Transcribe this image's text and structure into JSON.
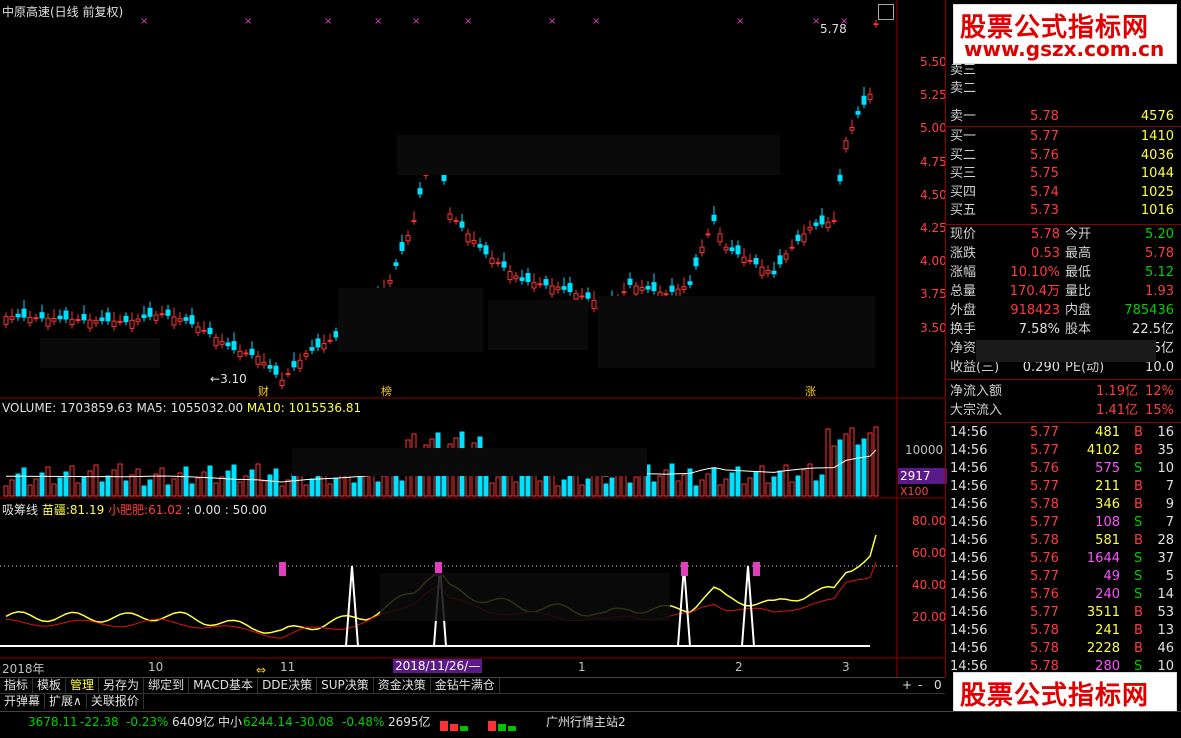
{
  "title": "中原高速(日线 前复权)",
  "colors": {
    "up": "#ff3232",
    "down": "#00e0ff",
    "bg": "#000000",
    "grid": "#8b0000",
    "ma5": "#ffffff",
    "ma10": "#ffff00"
  },
  "price_axis": [
    "5.50",
    "5.25",
    "5.00",
    "4.75",
    "4.50",
    "4.25",
    "4.00",
    "3.75",
    "3.50"
  ],
  "price_high_label": "5.78",
  "price_low_label": "3.10",
  "event_markers": [
    "财",
    "榜",
    "涨"
  ],
  "volume_header": {
    "prefix": "VOLUME:",
    "value": "1703859.63",
    "ma5_label": "MA5:",
    "ma5": "1055032.00",
    "ma10_label": "MA10:",
    "ma10": "1015536.81"
  },
  "volume_axis": [
    "10000"
  ],
  "volume_tag": "2917",
  "volume_unit": "X100",
  "indicator_header": {
    "name": "吸筹线",
    "a_label": "苗疆:",
    "a": "81.19",
    "b_label": "小肥肥:",
    "b": "61.02",
    "c": ": 0.00",
    "d": ": 50.00"
  },
  "indicator_axis": [
    "80.00",
    "60.00",
    "40.00",
    "20.00"
  ],
  "time_axis": [
    "2018年",
    "10",
    "11",
    "1",
    "2",
    "3"
  ],
  "time_cursor": "2018/11/26/—",
  "quote": {
    "asks": [
      {
        "label": "卖三",
        "price": "",
        "vol": ""
      },
      {
        "label": "卖二",
        "price": "",
        "vol": ""
      },
      {
        "label": "卖一",
        "price": "5.78",
        "vol": "4576"
      }
    ],
    "bids": [
      {
        "label": "买一",
        "price": "5.77",
        "vol": "1410"
      },
      {
        "label": "买二",
        "price": "5.76",
        "vol": "4036"
      },
      {
        "label": "买三",
        "price": "5.75",
        "vol": "1044"
      },
      {
        "label": "买四",
        "price": "5.74",
        "vol": "1025"
      },
      {
        "label": "买五",
        "price": "5.73",
        "vol": "1016"
      }
    ],
    "stats": [
      {
        "l1": "现价",
        "v1": "5.78",
        "l2": "今开",
        "v2": "5.20"
      },
      {
        "l1": "涨跌",
        "v1": "0.53",
        "l2": "最高",
        "v2": "5.78"
      },
      {
        "l1": "涨幅",
        "v1": "10.10%",
        "l2": "最低",
        "v2": "5.12"
      },
      {
        "l1": "总量",
        "v1": "170.4万",
        "l2": "量比",
        "v2": "1.93"
      },
      {
        "l1": "外盘",
        "v1": "918423",
        "l2": "内盘",
        "v2": "785436"
      },
      {
        "l1": "换手",
        "v1": "7.58%",
        "l2": "股本",
        "v2": "22.5亿"
      },
      {
        "l1": "净资",
        "v1": "",
        "l2": "",
        "v2": "22.5亿"
      },
      {
        "l1": "收益(三)",
        "v1": "0.290",
        "l2": "PE(动)",
        "v2": "10.0"
      }
    ],
    "flows": [
      {
        "label": "净流入额",
        "value": "1.19亿",
        "pct": "12%"
      },
      {
        "label": "大宗流入",
        "value": "1.41亿",
        "pct": "15%"
      }
    ]
  },
  "ticks": [
    {
      "time": "14:56",
      "price": "5.77",
      "vol": "481",
      "side": "B",
      "n": "16"
    },
    {
      "time": "14:56",
      "price": "5.77",
      "vol": "4102",
      "side": "B",
      "n": "35"
    },
    {
      "time": "14:56",
      "price": "5.76",
      "vol": "575",
      "side": "S",
      "n": "10"
    },
    {
      "time": "14:56",
      "price": "5.77",
      "vol": "211",
      "side": "B",
      "n": "7"
    },
    {
      "time": "14:56",
      "price": "5.78",
      "vol": "346",
      "side": "B",
      "n": "9"
    },
    {
      "time": "14:56",
      "price": "5.77",
      "vol": "108",
      "side": "S",
      "n": "7"
    },
    {
      "time": "14:56",
      "price": "5.78",
      "vol": "581",
      "side": "B",
      "n": "28"
    },
    {
      "time": "14:56",
      "price": "5.76",
      "vol": "1644",
      "side": "S",
      "n": "37"
    },
    {
      "time": "14:56",
      "price": "5.77",
      "vol": "49",
      "side": "S",
      "n": "5"
    },
    {
      "time": "14:56",
      "price": "5.76",
      "vol": "240",
      "side": "S",
      "n": "14"
    },
    {
      "time": "14:56",
      "price": "5.77",
      "vol": "3511",
      "side": "B",
      "n": "53"
    },
    {
      "time": "14:56",
      "price": "5.78",
      "vol": "241",
      "side": "B",
      "n": "13"
    },
    {
      "time": "14:56",
      "price": "5.78",
      "vol": "2228",
      "side": "B",
      "n": "46"
    },
    {
      "time": "14:56",
      "price": "5.78",
      "vol": "280",
      "side": "S",
      "n": "10"
    }
  ],
  "watermark": {
    "line1": "股票公式指标网",
    "line2": "www.gszx.com.cn"
  },
  "toolbar": [
    "指标",
    "模板",
    "管理",
    "另存为",
    "绑定到",
    "MACD基本",
    "DDE决策",
    "SUP决策",
    "资金决策",
    "金钻牛满仓"
  ],
  "toolbar_right": [
    "+",
    "-",
    "0"
  ],
  "toolbar2": [
    "开弹幕",
    "扩展∧",
    "关联报价"
  ],
  "status": {
    "sh_value": "3678.11",
    "sh_chg": "-22.38",
    "sh_pct": "-0.23%",
    "sh_amt": "6409亿",
    "sz_name": "中小",
    "sz_value": "6244.14",
    "sz_chg": "-30.08",
    "sz_pct": "-0.48%",
    "sz_amt": "2695亿",
    "server": "广州行情主站2"
  }
}
